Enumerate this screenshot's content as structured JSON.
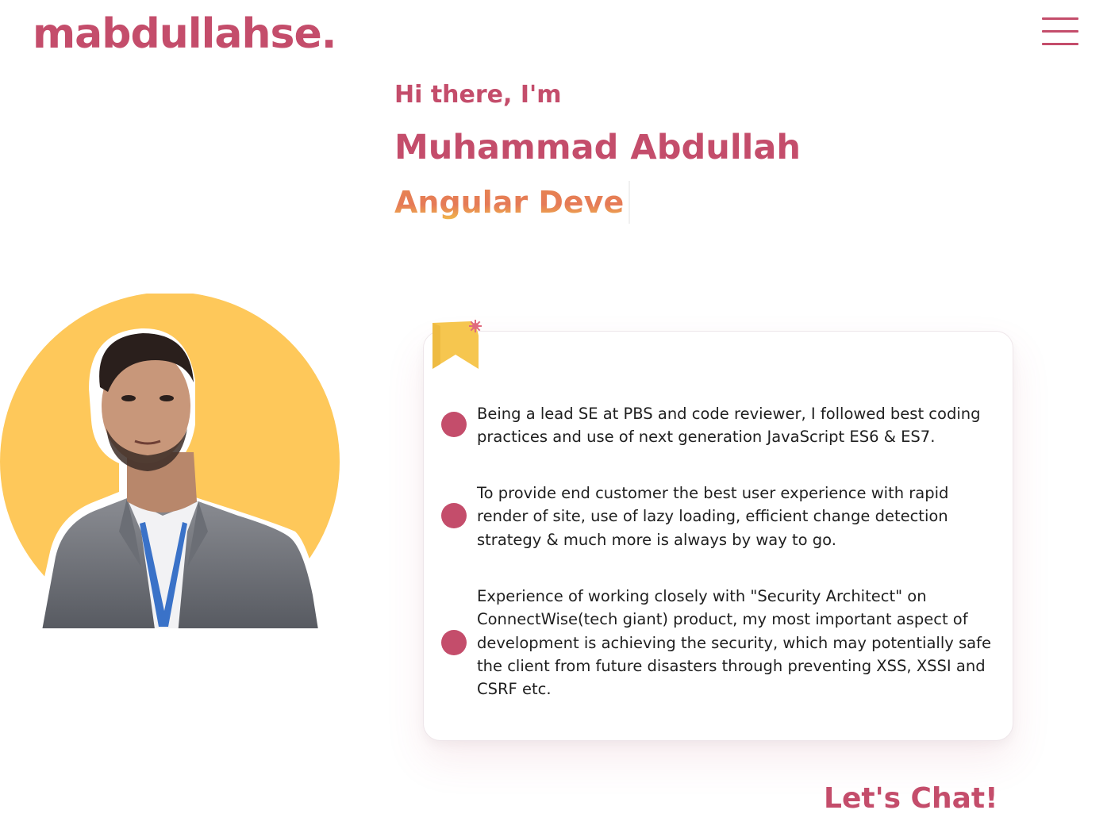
{
  "header": {
    "logo": "mabdullahse.",
    "menu_icon": "hamburger-menu-icon"
  },
  "hero": {
    "greeting": "Hi there, I'm",
    "name": "Muhammad Abdullah",
    "role_typed": "Angular Deve"
  },
  "profile": {
    "photo_icon": "profile-photo"
  },
  "card": {
    "badge_icon": "bookmark-icon",
    "points": [
      "Being a lead SE at PBS and code reviewer, I  followed best coding practices and use of next generation JavaScript ES6 & ES7.",
      "To provide end customer the best user experience with rapid render of site, use of lazy loading, efficient change detection strategy & much more is always by way to go.",
      "Experience of working closely with \"Security Architect\" on ConnectWise(tech giant) product, my most important aspect of development is achieving the security, which may potentially safe the client from future disasters  through preventing XSS, XSSI and CSRF etc."
    ]
  },
  "cta": {
    "label": "Let's Chat!"
  },
  "colors": {
    "brand": "#c44d6b",
    "accent_yellow": "#fec85a",
    "role_orange": "#e8874d"
  }
}
